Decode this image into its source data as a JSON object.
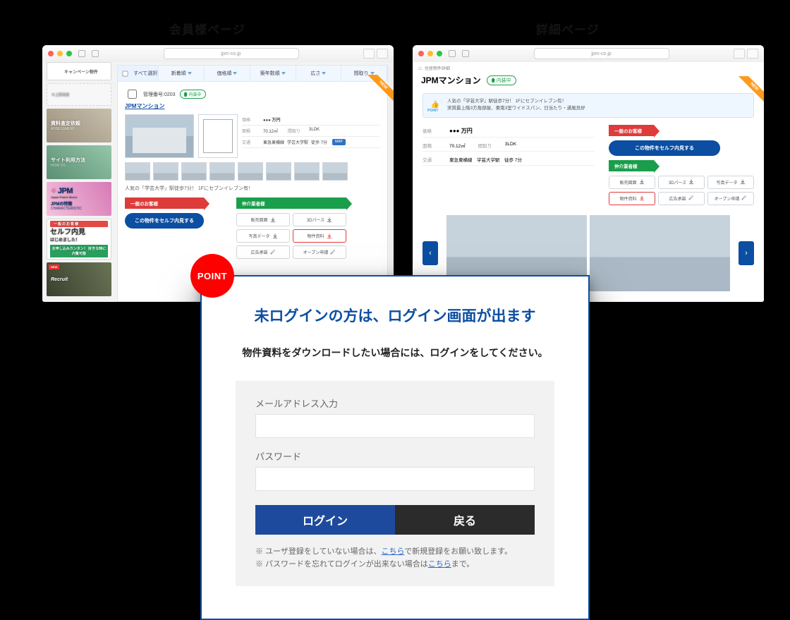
{
  "section_labels": {
    "left": "会員様ページ",
    "right": "詳細ページ"
  },
  "browser": {
    "url": "jpm-co.jp"
  },
  "sidebar": {
    "campaign": "キャンペーン物件",
    "blank": "※上限到達",
    "tiles": [
      {
        "title": "資料査定依頼",
        "sub": "ASSESSMENT"
      },
      {
        "title": "サイト利用方法",
        "sub": "HOW TO"
      },
      {
        "title": "JPMの特徴",
        "sub": "CHARACTERISTIC",
        "logo": "JPM",
        "logo_sub": "Japan Praise Mover"
      },
      {
        "ribbon": "一般のお客様",
        "big": "セルフ内見",
        "sub": "はじめました！",
        "bar": "お申し込みカンタン！\n好きな時に内覧可能"
      },
      {
        "title": "Recruit"
      }
    ]
  },
  "filters": [
    {
      "label": "すべて選択",
      "checkbox": true
    },
    {
      "label": "新着順"
    },
    {
      "label": "価格順"
    },
    {
      "label": "築年数順"
    },
    {
      "label": "広さ"
    },
    {
      "label": "間取り"
    }
  ],
  "listing": {
    "new_badge": "NEW",
    "mgmt": "管理番号:0203",
    "status": "内装中",
    "name": "JPMマンション",
    "specs": {
      "price_k": "価格",
      "price_v": "●●● 万円",
      "area_k": "面積",
      "area_v": "70.12㎡",
      "plan_k": "間取り",
      "plan_v": "3LDK",
      "trans_k": "交通",
      "trans_line": "東急東横線",
      "trans_st": "学芸大学駅",
      "trans_walk": "徒歩 7分",
      "map": "MAP"
    },
    "desc": "人気の「学芸大学」駅徒歩7分！ 1Fにセブンイレブン有！",
    "ribbon_customer": "一般のお客様",
    "ribbon_agent": "仲介業者様",
    "cta": "この物件をセルフ内見する",
    "dl": [
      "販売図面",
      "3Dパース",
      "写真データ",
      "物件資料",
      "広告承諾",
      "オープン申請"
    ]
  },
  "detail": {
    "crumb_home": "⌂",
    "crumb": "住居物件詳細",
    "title": "JPMマンション",
    "status": "内装中",
    "new_badge": "NEW",
    "point_lines": [
      "人気の「学芸大学」駅徒歩7分！ 1Fにセブンイレブン有！",
      "実質最上階3方角部屋、東南3室ワイドスパン、日当たり・通風良好"
    ],
    "point_label": "POINT",
    "specs": {
      "price_k": "価格",
      "price_v": "●●● 万円",
      "area_k": "面積",
      "area_v": "70.12㎡",
      "plan_k": "間取り",
      "plan_v": "3LDK",
      "trans_k": "交通",
      "trans_v": "東急東横線　学芸大学駅　徒歩 7分"
    },
    "dl": [
      "販売図面",
      "3Dパース",
      "写真データ",
      "物件資料",
      "広告承諾",
      "オープン申請"
    ]
  },
  "point_circle": "POINT",
  "login": {
    "title": "未ログインの方は、ログイン画面が出ます",
    "subtitle": "物件資料をダウンロードしたい場合には、ログインをしてください。",
    "email_label": "メールアドレス入力",
    "password_label": "パスワード",
    "login_btn": "ログイン",
    "back_btn": "戻る",
    "note1_a": "※ ユーザ登録をしていない場合は、",
    "note1_link": "こちら",
    "note1_b": "で新規登録をお願い致します。",
    "note2_a": "※ パスワードを忘れてログインが出来ない場合は",
    "note2_link": "こちら",
    "note2_b": "まで。"
  }
}
